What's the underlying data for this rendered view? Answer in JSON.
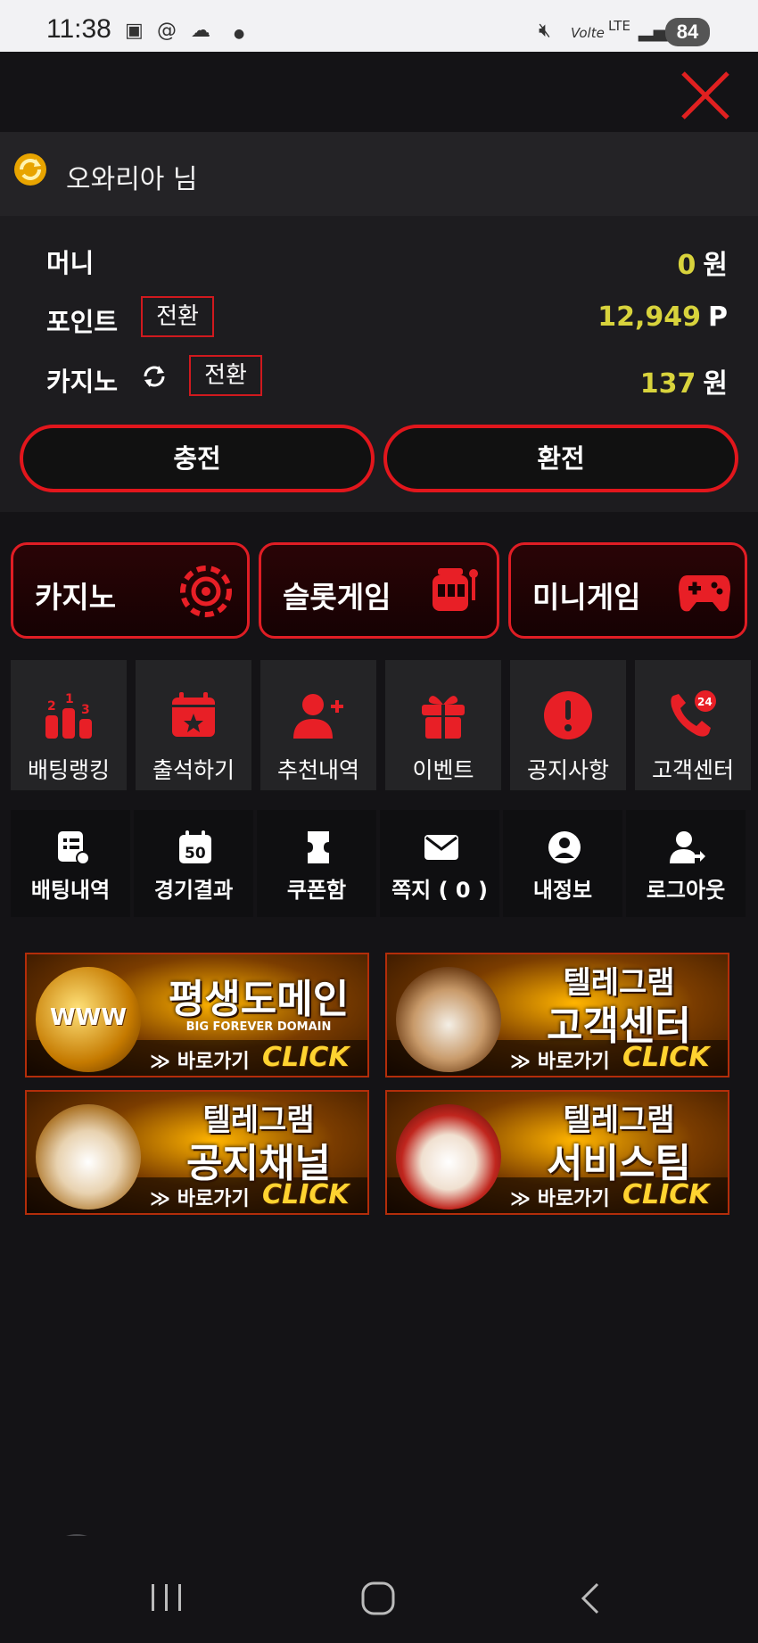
{
  "status_bar": {
    "time": "11:38",
    "battery": "84",
    "network": "LTE",
    "volte": "Volte"
  },
  "user": {
    "name": "오와리아 님"
  },
  "wallet": {
    "money_label": "머니",
    "money_value": "0",
    "money_unit": "원",
    "point_label": "포인트",
    "point_convert": "전환",
    "point_value": "12,949",
    "point_unit": "P",
    "casino_label": "카지노",
    "casino_convert": "전환",
    "casino_value": "137",
    "casino_unit": "원",
    "deposit_label": "충전",
    "withdraw_label": "환전"
  },
  "categories": [
    "카지노",
    "슬롯게임",
    "미니게임"
  ],
  "menu_primary": [
    "배팅랭킹",
    "출석하기",
    "추천내역",
    "이벤트",
    "공지사항",
    "고객센터"
  ],
  "menu_secondary": [
    "배팅내역",
    "경기결과",
    "쿠폰함",
    "쪽지 ( 0 )",
    "내정보",
    "로그아웃"
  ],
  "banners": [
    {
      "title": "평생도메인",
      "subtitle": "BIG FOREVER DOMAIN",
      "go": "바로가기",
      "click": "CLICK"
    },
    {
      "title_top": "텔레그램",
      "title": "고객센터",
      "go": "바로가기",
      "click": "CLICK"
    },
    {
      "title_top": "텔레그램",
      "title": "공지채널",
      "go": "바로가기",
      "click": "CLICK"
    },
    {
      "title_top": "텔레그램",
      "title": "서비스팀",
      "go": "바로가기",
      "click": "CLICK"
    }
  ],
  "banner_www": "WWW",
  "colors": {
    "accent_red": "#e01d24",
    "value_yellow": "#d8d33c",
    "background": "#141316"
  }
}
